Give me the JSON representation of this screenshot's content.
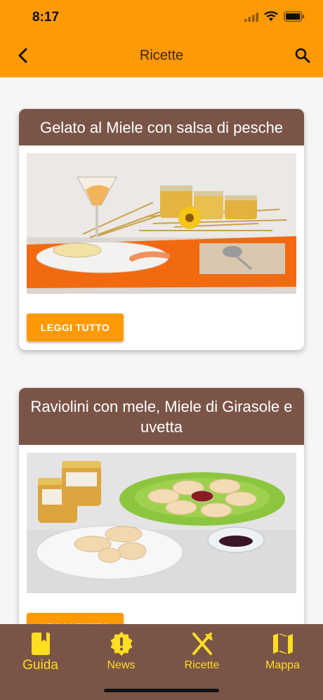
{
  "status_bar": {
    "time": "8:17"
  },
  "app_bar": {
    "title": "Ricette"
  },
  "recipes": [
    {
      "title": "Gelato al Miele con salsa di pesche",
      "button": "LEGGI TUTTO"
    },
    {
      "title": "Raviolini con mele, Miele di Girasole e uvetta",
      "button": "LEGGI TUTTO"
    }
  ],
  "bottom_nav": [
    {
      "label": "Guida",
      "icon": "book-icon"
    },
    {
      "label": "News",
      "icon": "alert-badge-icon"
    },
    {
      "label": "Ricette",
      "icon": "utensils-icon"
    },
    {
      "label": "Mappa",
      "icon": "map-icon"
    }
  ],
  "colors": {
    "primary": "#ff9a05",
    "brown": "#7a5547",
    "nav_accent": "#ffdd22"
  }
}
